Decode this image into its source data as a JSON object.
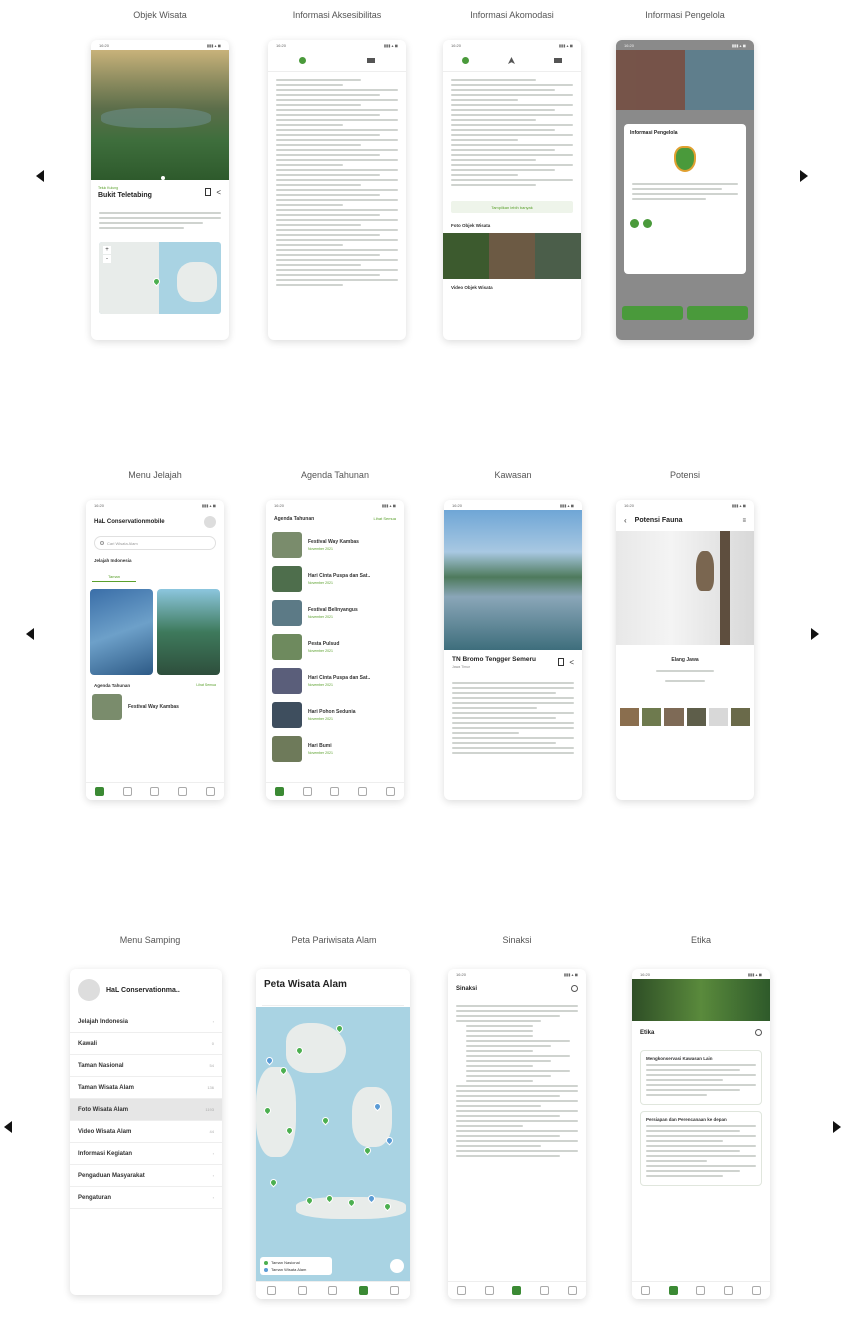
{
  "rows": [
    {
      "screens": [
        {
          "title": "Objek Wisata",
          "place_name": "Bukit Teletabing",
          "place_region": "Teluk Kulung",
          "map_zoom_in": "+",
          "map_zoom_out": "-"
        },
        {
          "title": "Informasi Aksesibilitas"
        },
        {
          "title": "Informasi Akomodasi",
          "button": "Tampilkan lebih banyak",
          "photo_section": "Foto Objek Wisata",
          "video_section": "Video Objek Wisata"
        },
        {
          "title": "Informasi Pengelola",
          "dialog_title": "Informasi Pengelola"
        }
      ]
    },
    {
      "screens": [
        {
          "title": "Menu Jelajah",
          "app_name": "HaL Conservationmobile",
          "search_placeholder": "Cari Wisata Alam",
          "section": "Jelajah Indonesia",
          "tab_active": "Taman",
          "agenda_label": "Agenda Tahunan",
          "agenda_link": "Lihat Semua",
          "agenda_item": "Festival Way Kambas"
        },
        {
          "title": "Agenda Tahunan",
          "header_label": "Agenda Tahunan",
          "header_link": "Lihat Semua",
          "items": [
            {
              "name": "Festival Way Kambas",
              "date": "November 2021"
            },
            {
              "name": "Hari Cinta Puspa dan Sat..",
              "date": "November 2021"
            },
            {
              "name": "Festival Belinyangus",
              "date": "November 2021"
            },
            {
              "name": "Pesta Pulsud",
              "date": "November 2021"
            },
            {
              "name": "Hari Cinta Puspa dan Sat..",
              "date": "November 2021"
            },
            {
              "name": "Hari Pohon Sedunia",
              "date": "November 2021"
            },
            {
              "name": "Hari Bumi",
              "date": "November 2021"
            }
          ]
        },
        {
          "title": "Kawasan",
          "place_name": "TN Bromo Tengger Semeru",
          "place_region": "Jawa Timur"
        },
        {
          "title": "Potensi",
          "header": "Potensi Fauna",
          "species": "Elang Jawa"
        }
      ]
    },
    {
      "screens": [
        {
          "title": "Menu Samping",
          "app_name": "HaL Conservationma..",
          "menu_items": [
            {
              "label": "Jelajah Indonesia",
              "count": ""
            },
            {
              "label": "Kawali",
              "count": "0"
            },
            {
              "label": "Taman Nasional",
              "count": "54"
            },
            {
              "label": "Taman Wisata Alam",
              "count": "136"
            },
            {
              "label": "Foto Wisata Alam",
              "count": "1193"
            },
            {
              "label": "Video Wisata Alam",
              "count": "44"
            },
            {
              "label": "Informasi Kegiatan",
              "count": ""
            },
            {
              "label": "Pengaduan Masyarakat",
              "count": ""
            },
            {
              "label": "Pengaturan",
              "count": ""
            }
          ]
        },
        {
          "title": "Peta Pariwisata Alam",
          "header": "Peta Wisata Alam",
          "legend_1": "Taman Nasional",
          "legend_2": "Taman Wisata Alam"
        },
        {
          "title": "Sinaksi",
          "header": "Sinaksi"
        },
        {
          "title": "Etika",
          "header": "Etika",
          "card1": "Mengkonservasi Kawasan Lain",
          "card2": "Persiapan dan Perencanaan ke depan"
        }
      ]
    }
  ],
  "colors": {
    "accent": "#4a9a3b",
    "map_sea": "#a9d3e3",
    "map_land": "#e8ecea"
  }
}
